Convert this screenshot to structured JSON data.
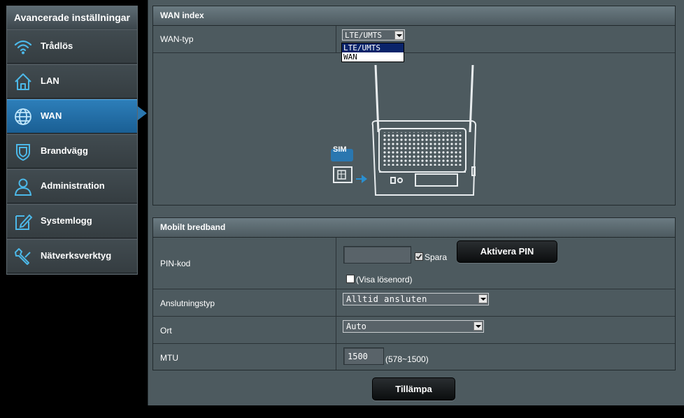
{
  "sidebar": {
    "title": "Avancerade inställningar",
    "items": [
      {
        "label": "Trådlös",
        "icon": "wifi-icon"
      },
      {
        "label": "LAN",
        "icon": "home-icon"
      },
      {
        "label": "WAN",
        "icon": "globe-icon",
        "active": true
      },
      {
        "label": "Brandvägg",
        "icon": "shield-icon"
      },
      {
        "label": "Administration",
        "icon": "user-icon"
      },
      {
        "label": "Systemlogg",
        "icon": "edit-icon"
      },
      {
        "label": "Nätverksverktyg",
        "icon": "wrench-icon"
      }
    ]
  },
  "wan_index": {
    "header": "WAN index",
    "wan_type_label": "WAN-typ",
    "wan_type_value": "LTE/UMTS",
    "wan_type_options": [
      "LTE/UMTS",
      "WAN"
    ],
    "sim_label": "SIM"
  },
  "mobile": {
    "header": "Mobilt bredband",
    "pin_label": "PIN-kod",
    "pin_value": "",
    "save_label": "Spara",
    "save_checked": true,
    "activate_pin_label": "Aktivera PIN",
    "show_password_label": "(Visa lösenord)",
    "connection_type_label": "Anslutningstyp",
    "connection_type_value": "Alltid ansluten",
    "location_label": "Ort",
    "location_value": "Auto",
    "mtu_label": "MTU",
    "mtu_value": "1500",
    "mtu_range": "(578~1500)"
  },
  "apply_label": "Tillämpa",
  "colors": {
    "accent": "#2a77b0",
    "panel": "#4d5a5f",
    "icon": "#4cb8e8"
  }
}
